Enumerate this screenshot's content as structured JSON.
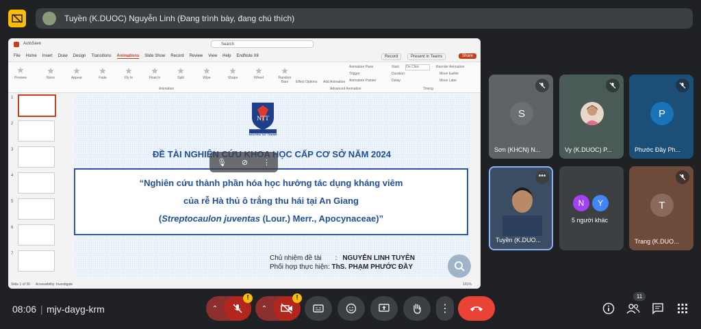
{
  "top_bar": {
    "presenter_label": "Tuyền (K.DUOC) Nguyễn Linh (Đang trình bày, đang chú thích)"
  },
  "ppt": {
    "autosave": "AutoSave",
    "search": "Search",
    "record": "Record",
    "present_in_teams": "Present in Teams",
    "share": "Share",
    "menu": [
      "File",
      "Home",
      "Insert",
      "Draw",
      "Design",
      "Transitions",
      "Animations",
      "Slide Show",
      "Record",
      "Review",
      "View",
      "Help",
      "EndNote X8"
    ],
    "preview": "Preview",
    "animations": [
      "None",
      "Appear",
      "Fade",
      "Fly In",
      "Float In",
      "Split",
      "Wipe",
      "Shape",
      "Wheel",
      "Random Bars"
    ],
    "effect_options": "Effect Options",
    "add_animation": "Add Animation",
    "animation_pane": "Animation Pane",
    "trigger": "Trigger",
    "animation_painter": "Animation Painter",
    "start": "Start:",
    "start_value": "On Click",
    "duration": "Duration:",
    "delay": "Delay:",
    "reorder": "Reorder Animation",
    "move_earlier": "Move Earlier",
    "move_later": "Move Later",
    "group_animation": "Animation",
    "group_advanced": "Advanced Animation",
    "group_timing": "Timing",
    "thumb_numbers": [
      "1",
      "2",
      "3",
      "4",
      "5",
      "6",
      "7"
    ],
    "status_left": "Slide 1 of 30",
    "status_accessibility": "Accessibility: Investigate",
    "status_zoom": "101%"
  },
  "slide": {
    "logo_text": "NGUYEN TAT THANH",
    "heading": "ĐỀ  TÀI  NGHIÊN CỨU KHOA HỌC CẤP CƠ SỞ NĂM 2024",
    "title_line1": "“Nghiên cứu thành phần hóa học hướng tác dụng kháng viêm",
    "title_line2": "của rễ Hà thủ ô trắng thu hái tại An Giang",
    "title_line3_italic": "Streptocaulon juventas",
    "title_line3_rest": " (Lour.) Merr., Apocynaceae)”",
    "title_line3_open": "(",
    "meta_label1": "Chủ nhiệm đề tài",
    "meta_colon": ":",
    "meta_value1": "NGUYỄN LINH TUYÊN",
    "meta_label2": "Phối hợp thực hiện:",
    "meta_value2": "ThS. PHẠM PHƯỚC ĐẦY"
  },
  "participants": [
    {
      "name": "Sơn (KHCN) N...",
      "initial": "S",
      "bg": "#5f6368",
      "avatar_bg": "#6b6e72"
    },
    {
      "name": "Vy (K.DUOC) P...",
      "initial": "",
      "bg": "#4a5a56"
    },
    {
      "name": "Phước Đầy Ph...",
      "initial": "P",
      "bg": "#1c4f78",
      "avatar_bg": "#1a73b8"
    },
    {
      "name": "Tuyền (K.DUO...",
      "initial": "",
      "bg": "#3b4d63"
    },
    {
      "name": "5 người khác",
      "initial_1": "N",
      "initial_2": "Y"
    },
    {
      "name": "Trang (K.DUO...",
      "initial": "T",
      "bg": "#6e4a3a",
      "avatar_bg": "#8a6a5a"
    }
  ],
  "bottom": {
    "time": "08:06",
    "separator": "|",
    "meeting_code": "mjv-dayg-krm",
    "badge": "!",
    "people_count": "11"
  }
}
